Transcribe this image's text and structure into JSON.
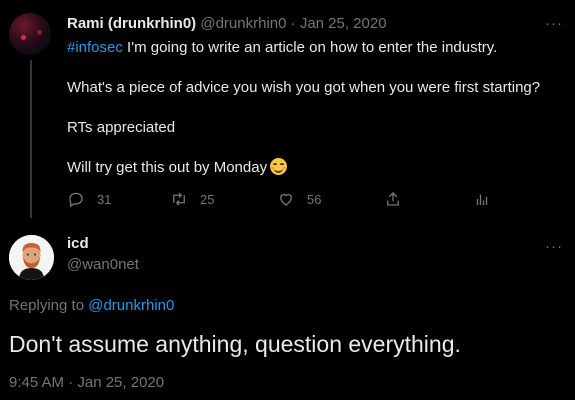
{
  "tweet": {
    "author_name": "Rami (drunkrhin0)",
    "author_handle": "@drunkrhin0",
    "separator": "·",
    "date": "Jan 25, 2020",
    "more_label": "···",
    "hashtag": "#infosec",
    "line1_rest": " I'm going to write an article on how to enter the industry.",
    "line2": "What's a piece of advice you wish you got when you were first starting?",
    "line3": "RTs appreciated",
    "line4": "Will try get this out by Monday",
    "emoji_icon": "smiling-face-icon",
    "actions": {
      "reply_count": "31",
      "retweet_count": "25",
      "like_count": "56"
    }
  },
  "reply": {
    "author_name": "icd",
    "author_handle": "@wan0net",
    "more_label": "···",
    "replying_prefix": "Replying to ",
    "replying_mention": "@drunkrhin0",
    "text": "Don't assume anything, question everything.",
    "timestamp": "9:45 AM · Jan 25, 2020"
  },
  "colors": {
    "background": "#000000",
    "text": "#e7e9ea",
    "muted": "#71767b",
    "accent": "#1d9bf0"
  }
}
